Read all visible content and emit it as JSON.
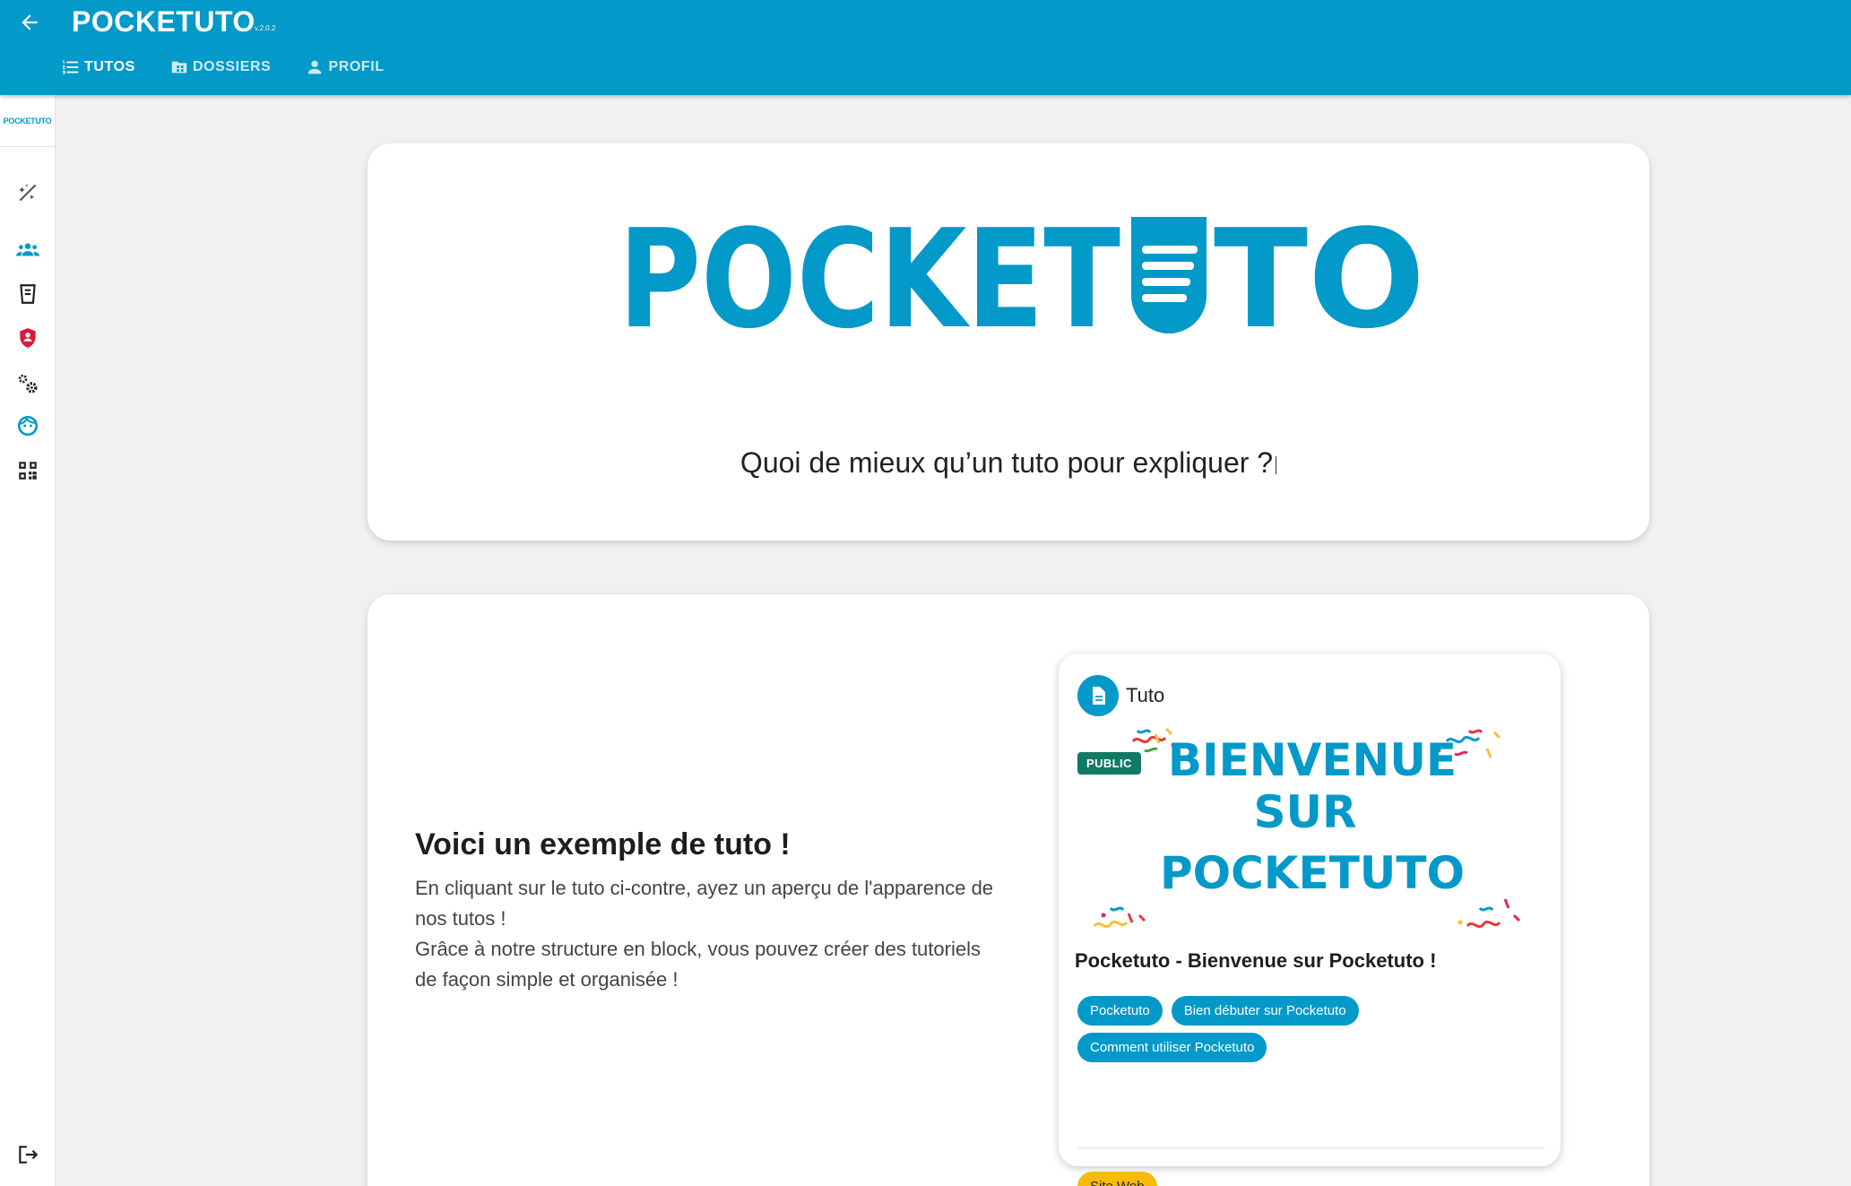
{
  "appbar": {
    "title": "POCKETUTO",
    "version": "v.2.0.2",
    "tabs": [
      {
        "label": "TUTOS",
        "icon": "list-numbered-icon"
      },
      {
        "label": "DOSSIERS",
        "icon": "folder-icon"
      },
      {
        "label": "PROFIL",
        "icon": "person-icon"
      }
    ]
  },
  "rail": {
    "logo_text": "POCKETUTO",
    "icons": [
      "magic-wand-off-icon",
      "group-icon",
      "trash-list-icon",
      "shield-user-icon",
      "gears-icon",
      "support-face-icon",
      "qr-code-icon",
      "logout-icon"
    ]
  },
  "hero": {
    "logo_text": "POCKETUTO",
    "tagline": "Quoi de mieux qu’un tuto pour expliquer ?"
  },
  "example": {
    "heading": "Voici un exemple de tuto !",
    "line1": "En cliquant sur le tuto ci-contre, ayez un aperçu de l'apparence de nos tutos !",
    "line2": "Grâce à notre structure en block, vous pouvez créer des tutoriels de façon simple et organisée !"
  },
  "tuto_card": {
    "type_label": "Tuto",
    "badge": "PUBLIC",
    "banner_line1": "BIENVENUE",
    "banner_line2": "SUR",
    "banner_line3": "POCKETUTO",
    "title": "Pocketuto - Bienvenue sur Pocketuto !",
    "chips": [
      "Pocketuto",
      "Bien débuter sur Pocketuto",
      "Comment utiliser Pocketuto"
    ],
    "site_chip": "Site Web"
  },
  "colors": {
    "primary": "#0399c9",
    "badge_green": "#117a66",
    "site_yellow": "#f6bb0b",
    "shield_red": "#d81b38"
  }
}
